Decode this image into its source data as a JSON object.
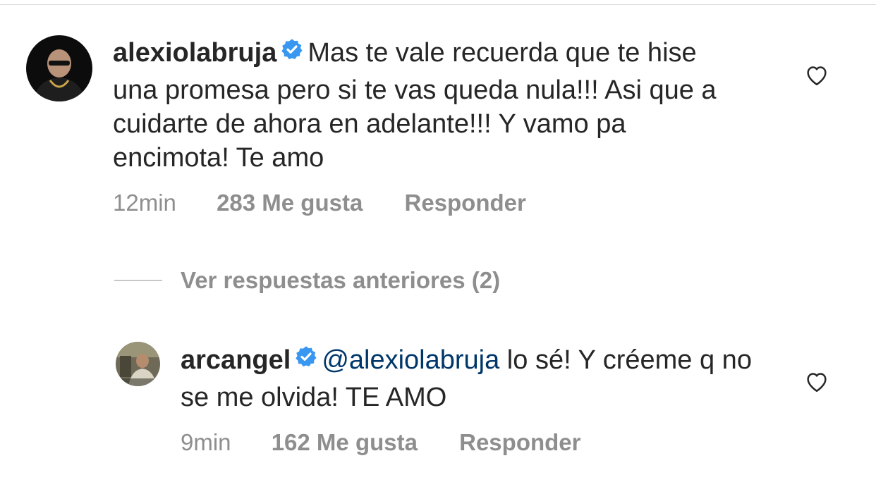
{
  "comments": [
    {
      "username": "alexiolabruja",
      "text": "Mas te vale recuerda que te hise una promesa pero si te vas queda nula!!! Asi que a cuidarte de ahora en adelante!!! Y vamo pa encimota! Te amo",
      "time": "12min",
      "likes": "283 Me gusta",
      "reply_label": "Responder"
    }
  ],
  "view_replies_label": "Ver respuestas anteriores (2)",
  "replies": [
    {
      "username": "arcangel",
      "mention": "@alexiolabruja",
      "text": " lo sé! Y créeme q no se me olvida! TE AMO",
      "time": "9min",
      "likes": "162 Me gusta",
      "reply_label": "Responder"
    }
  ],
  "colors": {
    "text": "#262626",
    "secondary": "#8e8e8e",
    "verified": "#3897f0",
    "mention": "#00376b"
  },
  "icons": {
    "verified": "verified-badge-icon",
    "like": "heart-outline-icon"
  }
}
